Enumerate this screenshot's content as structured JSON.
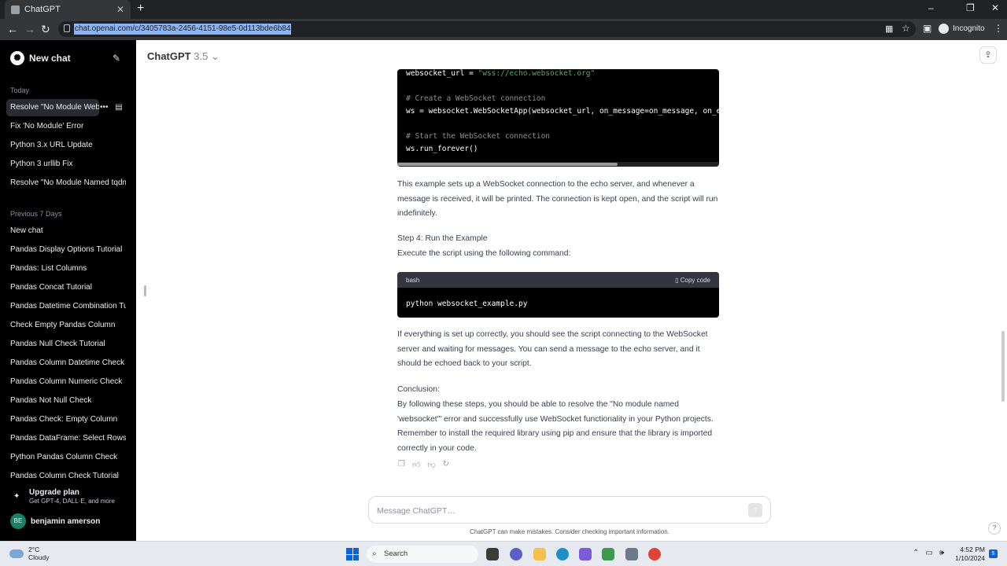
{
  "browser": {
    "tab_title": "ChatGPT",
    "url": "chat.openai.com/c/3405783a-2456-4151-98e5-0d113bde6b84",
    "incognito_label": "Incognito"
  },
  "sidebar": {
    "new_chat": "New chat",
    "today_label": "Today",
    "today_items": [
      "Resolve \"No Module WebSocket\"",
      "Fix 'No Module' Error",
      "Python 3.x URL Update",
      "Python 3 urllib Fix",
      "Resolve \"No Module Named tqdm\""
    ],
    "prev7_label": "Previous 7 Days",
    "prev7_items": [
      "New chat",
      "Pandas Display Options Tutorial",
      "Pandas: List Columns",
      "Pandas Concat Tutorial",
      "Pandas Datetime Combination Tutorial",
      "Check Empty Pandas Column",
      "Pandas Null Check Tutorial",
      "Pandas Column Datetime Check",
      "Pandas Column Numeric Check",
      "Pandas Not Null Check",
      "Pandas Check: Empty Column",
      "Pandas DataFrame: Select Rows",
      "Python Pandas Column Check",
      "Pandas Column Check Tutorial"
    ],
    "upgrade_title": "Upgrade plan",
    "upgrade_sub": "Get GPT-4, DALL·E, and more",
    "user_initials": "BE",
    "user_name": "benjamin amerson"
  },
  "main": {
    "model_name": "ChatGPT",
    "model_version": "3.5",
    "code1": {
      "line1_prefix": "websocket_url = ",
      "line1_str": "\"wss://echo.websocket.org\"",
      "line2": "# Create a WebSocket connection",
      "line3": "ws = websocket.WebSocketApp(websocket_url, on_message=on_message, on_er",
      "line4": "# Start the WebSocket connection",
      "line5": "ws.run_forever()"
    },
    "para1": "This example sets up a WebSocket connection to the echo server, and whenever a message is received, it will be printed. The connection is kept open, and the script will run indefinitely.",
    "step4_title": "Step 4: Run the Example",
    "step4_text": "Execute the script using the following command:",
    "code2": {
      "lang": "bash",
      "copy_label": "Copy code",
      "command": "python websocket_example.py"
    },
    "para2": "If everything is set up correctly, you should see the script connecting to the WebSocket server and waiting for messages. You can send a message to the echo server, and it should be echoed back to your script.",
    "conclusion_title": "Conclusion:",
    "conclusion_text": "By following these steps, you should be able to resolve the \"No module named 'websocket'\" error and successfully use WebSocket functionality in your Python projects. Remember to install the required library using pip and ensure that the library is imported correctly in your code.",
    "input_placeholder": "Message ChatGPT…",
    "disclaimer": "ChatGPT can make mistakes. Consider checking important information.",
    "help": "?"
  },
  "taskbar": {
    "temp": "2°C",
    "weather": "Cloudy",
    "search": "Search",
    "time": "4:52 PM",
    "date": "1/10/2024",
    "notifications": "5"
  }
}
